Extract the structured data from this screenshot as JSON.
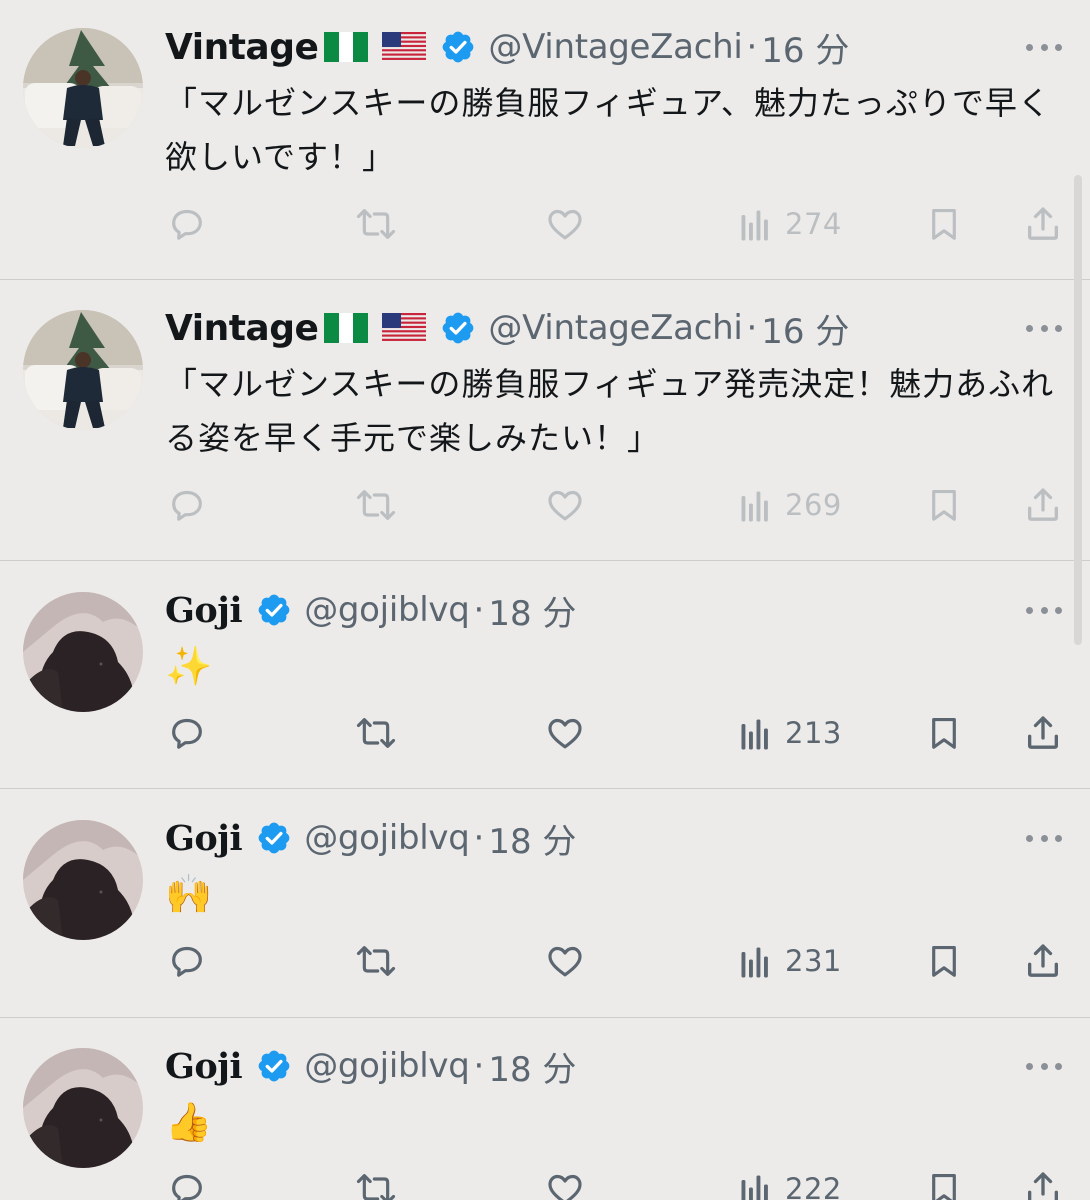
{
  "tweets": [
    {
      "name": "Vintage",
      "handle": "@VintageZachi",
      "separator": "·",
      "time": "16 分",
      "text": "「マルゼンスキーの勝負服フィギュア、魅力たっぷりで早く欲しいです！」",
      "views": "274"
    },
    {
      "name": "Vintage",
      "handle": "@VintageZachi",
      "separator": "·",
      "time": "16 分",
      "text": "「マルゼンスキーの勝負服フィギュア発売決定！魅力あふれる姿を早く手元で楽しみたい！」",
      "views": "269"
    },
    {
      "name": "Goji",
      "handle": "@gojiblvq",
      "separator": "·",
      "time": "18 分",
      "text": "✨",
      "views": "213"
    },
    {
      "name": "Goji",
      "handle": "@gojiblvq",
      "separator": "·",
      "time": "18 分",
      "text": "🙌",
      "views": "231"
    },
    {
      "name": "Goji",
      "handle": "@gojiblvq",
      "separator": "·",
      "time": "18 分",
      "text": "👍",
      "views": "222"
    }
  ],
  "icons": {
    "reply": "reply-icon",
    "retweet": "retweet-icon",
    "like": "like-icon",
    "views": "views-icon",
    "bookmark": "bookmark-icon",
    "share": "share-icon",
    "more": "more-icon",
    "verified": "verified-badge-icon",
    "flags": [
      "nigeria-flag-icon",
      "usa-flag-icon"
    ]
  },
  "colors": {
    "background": "#ecebea",
    "verified": "#1d9bf0",
    "secondary_text": "#5b6670"
  }
}
